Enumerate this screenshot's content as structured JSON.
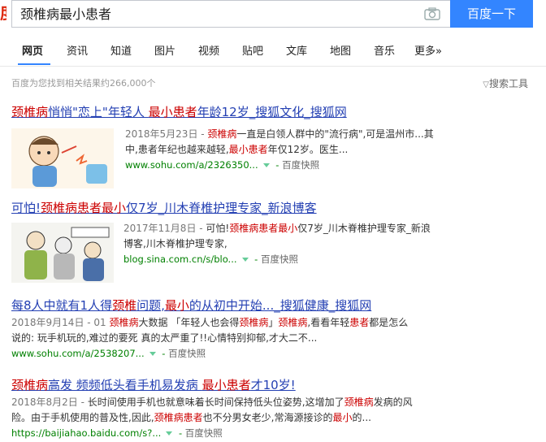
{
  "header": {
    "logo_fragment": "度",
    "query": "颈椎病最小患者",
    "search_button": "百度一下"
  },
  "tabs": [
    {
      "label": "网页"
    },
    {
      "label": "资讯"
    },
    {
      "label": "知道"
    },
    {
      "label": "图片"
    },
    {
      "label": "视频"
    },
    {
      "label": "贴吧"
    },
    {
      "label": "文库"
    },
    {
      "label": "地图"
    },
    {
      "label": "音乐"
    },
    {
      "label": "更多»"
    }
  ],
  "stats": "百度为您找到相关结果约266,000个",
  "tools": "搜索工具",
  "results": [
    {
      "title": [
        "颈椎病",
        "悄悄\"恋上\"年轻人 ",
        "最小患者",
        "年龄12岁_搜狐文化_搜狐网"
      ],
      "date": "2018年5月23日 - ",
      "snippet1": [
        "",
        "颈椎病",
        "一直是白领人群中的\"流行病\",可是温州市...其"
      ],
      "snippet2": [
        "中,患者年纪也越来越轻,",
        "最小患者",
        "年仅12岁。医生..."
      ],
      "url": "www.sohu.com/a/2326350...",
      "cache": "百度快照"
    },
    {
      "title": [
        "可怕!",
        "颈椎病患者最小",
        "仅7岁_川木脊椎护理专家_新浪博客"
      ],
      "date": "2017年11月8日 - ",
      "snippet1": [
        "可怕!",
        "颈椎病患者最小",
        "仅7岁_川木脊椎护理专家_新浪"
      ],
      "snippet2": [
        "博客,川木脊椎护理专家,"
      ],
      "url": "blog.sina.com.cn/s/blo...",
      "cache": "百度快照"
    },
    {
      "title": [
        "每8人中就有1人得",
        "颈椎",
        "问题,",
        "最小",
        "的从初中开始..._搜狐健康_搜狐网"
      ],
      "date": "2018年9月14日 - 01 ",
      "snippet1": [
        "",
        "颈椎病",
        "大数据 「年轻人也会得",
        "颈椎病",
        "」",
        "颈椎病",
        ",看看年轻",
        "患者",
        "都是怎么"
      ],
      "snippet2": [
        "说的: 玩手机玩的,难过的要死 真的太严重了!!心情特别抑郁,才大二不..."
      ],
      "url": "www.sohu.com/a/2538207...",
      "cache": "百度快照"
    },
    {
      "title": [
        "颈椎病",
        "高发 频频低头看手机易发病 ",
        "最小患者",
        "才10岁!"
      ],
      "date": "2018年8月2日 - ",
      "snippet1": [
        "长时间使用手机也就意味着长时间保持低头位姿势,这增加了",
        "颈椎病",
        "发病的风"
      ],
      "snippet2": [
        "险。由于手机使用的普及性,因此,",
        "颈椎病患者",
        "也不分男女老少,常海源接诊的",
        "最小",
        "的..."
      ],
      "url": "https://baijiahao.baidu.com/s?...",
      "cache": "百度快照"
    }
  ],
  "thumbs": [
    {
      "icon": "cartoon-boy-neck-pain"
    },
    {
      "icon": "cartoon-elderly-people-neck-pain"
    }
  ]
}
